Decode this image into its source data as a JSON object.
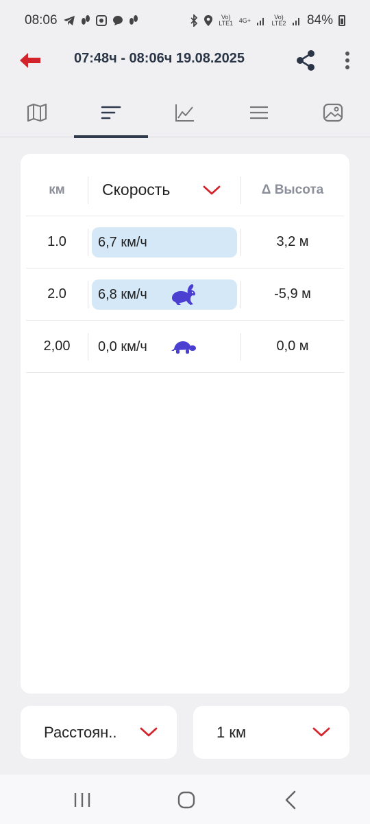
{
  "status_bar": {
    "time": "08:06",
    "battery": "84%",
    "notification_icons": [
      "telegram-icon",
      "steps-icon",
      "app-icon",
      "chat-icon",
      "steps-icon"
    ],
    "system_icons": [
      "bluetooth-icon",
      "location-icon",
      "signal-lte1-icon",
      "signal-4g-icon",
      "signal-lte2-icon"
    ],
    "signal_text_1": "Vo) LTE1",
    "signal_text_2": "4G+",
    "signal_text_3": "Vo) LTE2"
  },
  "app_bar": {
    "title": "07:48ч - 08:06ч  19.08.2025",
    "back_icon": "arrow-left-icon",
    "share_icon": "share-icon",
    "more_icon": "more-vert-icon",
    "accent_color": "#d3242b"
  },
  "tabs": [
    {
      "icon": "map-icon",
      "active": false
    },
    {
      "icon": "sort-icon",
      "active": true
    },
    {
      "icon": "chart-icon",
      "active": false
    },
    {
      "icon": "list-icon",
      "active": false
    },
    {
      "icon": "photo-icon",
      "active": false
    }
  ],
  "table": {
    "headers": {
      "km": "км",
      "speed": "Скорость",
      "elevation": "Δ Высота"
    },
    "rows": [
      {
        "km": "1.0",
        "speed": "6,7 км/ч",
        "elevation": "3,2 м",
        "highlight": true,
        "badge": ""
      },
      {
        "km": "2.0",
        "speed": "6,8 км/ч",
        "elevation": "-5,9 м",
        "highlight": true,
        "badge": "rabbit-icon"
      },
      {
        "km": "2,00",
        "speed": "0,0 км/ч",
        "elevation": "0,0 м",
        "highlight": false,
        "badge": "turtle-icon"
      }
    ],
    "highlight_color": "#d5e8f8",
    "badge_color": "#4a3fd1"
  },
  "selectors": {
    "left": {
      "value": "Расстоян.."
    },
    "right": {
      "value": "1 км"
    }
  },
  "nav_bar": {
    "icons": [
      "recent-apps-icon",
      "home-icon",
      "back-nav-icon"
    ]
  }
}
